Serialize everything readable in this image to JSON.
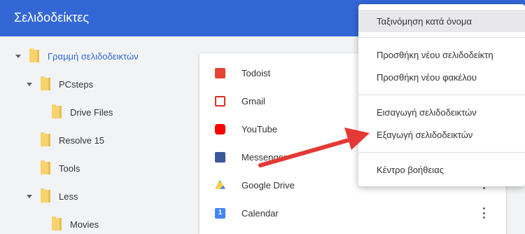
{
  "header": {
    "title": "Σελιδοδείκτες"
  },
  "tree": {
    "items": [
      {
        "label": "Γραμμή σελιδοδεικτών",
        "expanded": true,
        "selected": true
      },
      {
        "label": "PCsteps",
        "expanded": true
      },
      {
        "label": "Drive Files"
      },
      {
        "label": "Resolve 15"
      },
      {
        "label": "Tools"
      },
      {
        "label": "Less",
        "expanded": true
      },
      {
        "label": "Movies"
      }
    ]
  },
  "bookmarks": [
    {
      "label": "Todoist",
      "icon": "todoist-icon"
    },
    {
      "label": "Gmail",
      "icon": "gmail-icon"
    },
    {
      "label": "YouTube",
      "icon": "youtube-icon"
    },
    {
      "label": "Messenger",
      "icon": "facebook-icon"
    },
    {
      "label": "Google Drive",
      "icon": "google-drive-icon"
    },
    {
      "label": "Calendar",
      "icon": "calendar-icon",
      "badge": "1"
    }
  ],
  "menu": {
    "items": [
      {
        "label": "Ταξινόμηση κατά όνομα",
        "highlighted": true
      },
      {
        "label": "Προσθήκη νέου σελιδοδείκτη"
      },
      {
        "label": "Προσθήκη νέου φακέλου"
      },
      {
        "label": "Εισαγωγή σελιδοδεικτών"
      },
      {
        "label": "Εξαγωγή σελιδοδεικτών"
      },
      {
        "label": "Κέντρο βοήθειας"
      }
    ]
  },
  "colors": {
    "header": "#3367d6",
    "arrow": "#e53935",
    "folder": "#f6d36d"
  }
}
